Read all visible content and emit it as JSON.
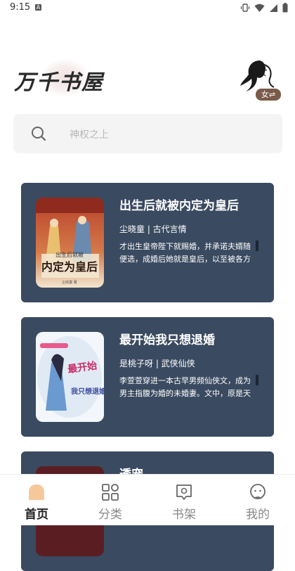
{
  "status_bar": {
    "time": "9:15",
    "notif_letter": "A"
  },
  "header": {
    "logo_text": "万千书屋",
    "gender_toggle_label": "女⇌"
  },
  "search": {
    "placeholder": "神权之上"
  },
  "books": [
    {
      "title": "出生后就被内定为皇后",
      "meta": "尘晓童 | 古代言情",
      "description": "才出生皇帝陛下就赐婚，并承诺夫婿随便选，成婚后她就是皇后，以至被各方",
      "cover_text_1": "出生后就被",
      "cover_text_2": "内定为皇后",
      "cover_author": "尘晓童 著"
    },
    {
      "title": "最开始我只想退婚",
      "meta": "是桃子呀 | 武侠仙侠",
      "description": "李萱萱穿进一本古早男频仙侠文，成为男主指腹为婚的未婚妻。文中，原是天",
      "cover_text_1": "最开始",
      "cover_text_2": "我只想退婚"
    },
    {
      "title": "透宠",
      "meta": "",
      "description": ""
    }
  ],
  "tabs": [
    {
      "label": "首页",
      "icon": "home-icon",
      "active": true
    },
    {
      "label": "分类",
      "icon": "category-icon",
      "active": false
    },
    {
      "label": "书架",
      "icon": "bookshelf-icon",
      "active": false
    },
    {
      "label": "我的",
      "icon": "profile-icon",
      "active": false
    }
  ],
  "colors": {
    "card_bg": "#3a4a60",
    "active_tab_icon": "#f5c89a",
    "accent_badge": "#7a5a48"
  }
}
